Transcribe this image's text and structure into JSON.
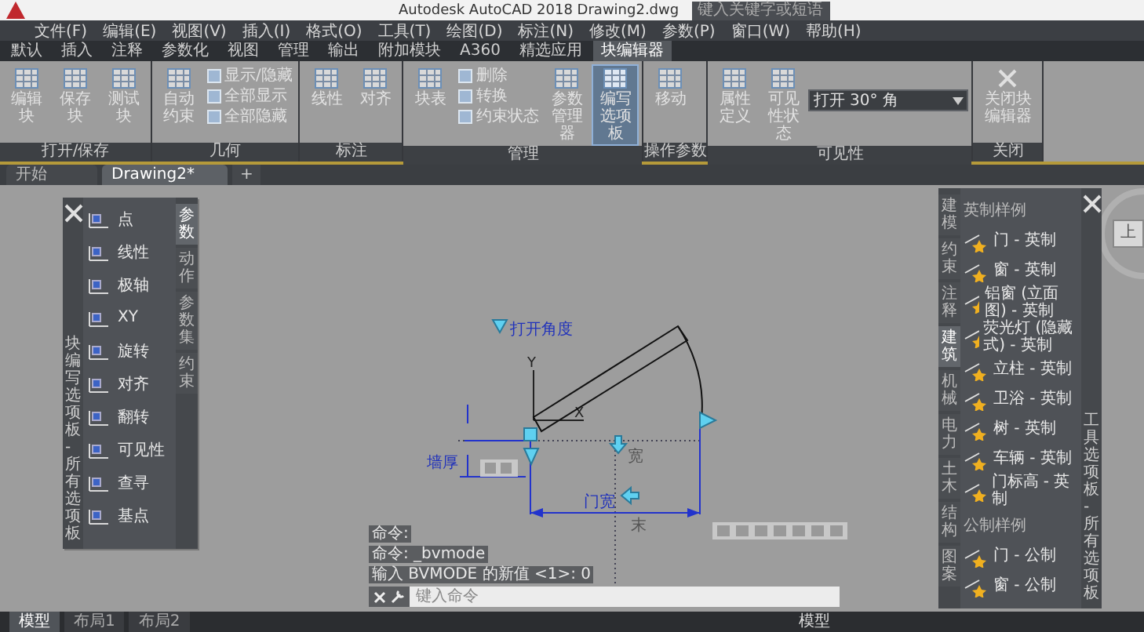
{
  "window": {
    "title": "Autodesk AutoCAD 2018    Drawing2.dwg",
    "search_placeholder": "键入关键字或短语"
  },
  "menu": [
    "文件(F)",
    "编辑(E)",
    "视图(V)",
    "插入(I)",
    "格式(O)",
    "工具(T)",
    "绘图(D)",
    "标注(N)",
    "修改(M)",
    "参数(P)",
    "窗口(W)",
    "帮助(H)"
  ],
  "ribbon_tabs": [
    {
      "label": "默认",
      "selected": false
    },
    {
      "label": "插入",
      "selected": false
    },
    {
      "label": "注释",
      "selected": false
    },
    {
      "label": "参数化",
      "selected": false
    },
    {
      "label": "视图",
      "selected": false
    },
    {
      "label": "管理",
      "selected": false
    },
    {
      "label": "输出",
      "selected": false
    },
    {
      "label": "附加模块",
      "selected": false
    },
    {
      "label": "A360",
      "selected": false
    },
    {
      "label": "精选应用",
      "selected": false
    },
    {
      "label": "块编辑器",
      "selected": true
    }
  ],
  "ribbon_panels": [
    {
      "title": "打开/保存",
      "tools": [
        {
          "kind": "big",
          "label": "编辑块",
          "on": false
        },
        {
          "kind": "big",
          "label": "保存块",
          "on": false
        },
        {
          "kind": "big",
          "label": "测试块",
          "on": false
        }
      ]
    },
    {
      "title": "几何",
      "tools": [
        {
          "kind": "big",
          "label": "自动约束",
          "on": false
        },
        {
          "kind": "small",
          "label": "显示/隐藏",
          "on": false
        },
        {
          "kind": "small",
          "label": "全部显示",
          "on": false
        },
        {
          "kind": "small",
          "label": "全部隐藏",
          "on": false
        }
      ]
    },
    {
      "title": "标注",
      "tools": [
        {
          "kind": "big",
          "label": "线性",
          "on": false
        },
        {
          "kind": "big",
          "label": "对齐",
          "on": false
        }
      ]
    },
    {
      "title": "管理",
      "tools": [
        {
          "kind": "big",
          "label": "块表",
          "on": false
        },
        {
          "kind": "small",
          "label": "删除",
          "on": false
        },
        {
          "kind": "small",
          "label": "转换",
          "on": false
        },
        {
          "kind": "small",
          "label": "约束状态",
          "on": false
        },
        {
          "kind": "big",
          "label": "参数管理器",
          "on": false
        },
        {
          "kind": "big",
          "label": "编写选项板",
          "on": true
        }
      ]
    },
    {
      "title": "操作参数",
      "tools": [
        {
          "kind": "big",
          "label": "移动",
          "on": false
        }
      ]
    },
    {
      "title": "可见性",
      "tools": [
        {
          "kind": "big",
          "label": "属性定义",
          "on": false
        },
        {
          "kind": "big",
          "label": "可见性状态",
          "on": false
        },
        {
          "kind": "dropdown",
          "label": "打开 30° 角",
          "on": false
        }
      ]
    },
    {
      "title": "关闭",
      "tools": [
        {
          "kind": "close",
          "label": "关闭块编辑器",
          "on": false
        }
      ]
    }
  ],
  "doc_tabs": [
    {
      "label": "开始",
      "selected": false
    },
    {
      "label": "Drawing2*",
      "selected": true
    }
  ],
  "new_tab": "+",
  "left_palette": {
    "title": "块编写选项板 - 所有选项板",
    "items": [
      {
        "label": "点"
      },
      {
        "label": "线性"
      },
      {
        "label": "极轴"
      },
      {
        "label": "XY"
      },
      {
        "label": "旋转"
      },
      {
        "label": "对齐"
      },
      {
        "label": "翻转"
      },
      {
        "label": "可见性"
      },
      {
        "label": "查寻"
      },
      {
        "label": "基点"
      }
    ],
    "tabs": [
      {
        "label": "参数",
        "selected": true
      },
      {
        "label": "动作",
        "selected": false
      },
      {
        "label": "参数集",
        "selected": false
      },
      {
        "label": "约束",
        "selected": false
      }
    ]
  },
  "right_palette": {
    "title": "工具选项板 - 所有选项板",
    "tabs": [
      {
        "label": "建模",
        "selected": false
      },
      {
        "label": "约束",
        "selected": false
      },
      {
        "label": "注释",
        "selected": false
      },
      {
        "label": "建筑",
        "selected": true
      },
      {
        "label": "机械",
        "selected": false
      },
      {
        "label": "电力",
        "selected": false
      },
      {
        "label": "土木",
        "selected": false
      },
      {
        "label": "结构",
        "selected": false
      },
      {
        "label": "图案",
        "selected": false
      }
    ],
    "sections": [
      {
        "title": "英制样例",
        "items": [
          "门 - 英制",
          "窗 - 英制",
          "铝窗 (立面图) - 英制",
          "荧光灯 (隐藏式) - 英制",
          "立柱 - 英制",
          "卫浴 - 英制",
          "树 - 英制",
          "车辆 - 英制",
          "门标高 - 英制"
        ]
      },
      {
        "title": "公制样例",
        "items": [
          "门 - 公制",
          "窗 - 公制"
        ]
      }
    ]
  },
  "viewcube": {
    "face": "上"
  },
  "drawing": {
    "angle_label": "打开角度",
    "wall_label": "墙厚",
    "width_label": "门宽",
    "grip_label": "宽",
    "end_label": "末",
    "x_axis": "X",
    "y_axis": "Y"
  },
  "command": {
    "history": [
      "命令:",
      "命令: _bvmode",
      "输入 BVMODE 的新值 <1>: 0"
    ],
    "placeholder": "键入命令"
  },
  "layout_tabs": [
    {
      "label": "模型",
      "selected": true
    },
    {
      "label": "布局1",
      "selected": false
    },
    {
      "label": "布局2",
      "selected": false
    }
  ],
  "status_model": "模型"
}
